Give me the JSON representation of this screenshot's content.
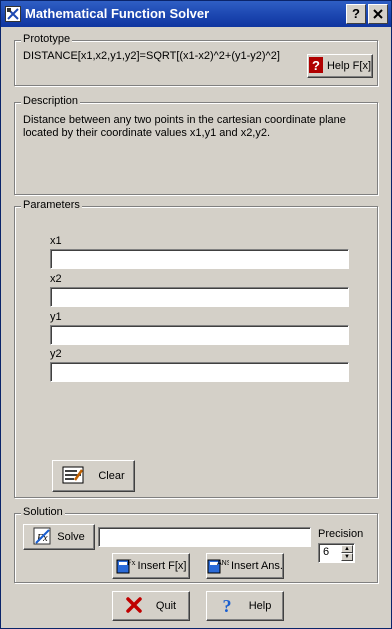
{
  "window": {
    "title": "Mathematical Function Solver",
    "help_button": "?",
    "close_button": "X"
  },
  "prototype": {
    "label": "Prototype",
    "text": "DISTANCE[x1,x2,y1,y2]=SQRT[(x1-x2)^2+(y1-y2)^2]",
    "help_button": "Help F[x]"
  },
  "description": {
    "label": "Description",
    "text": "Distance between any two points in the cartesian coordinate plane located by their coordinate values x1,y1 and x2,y2."
  },
  "parameters": {
    "label": "Parameters",
    "fields": [
      {
        "label": "x1",
        "value": ""
      },
      {
        "label": "x2",
        "value": ""
      },
      {
        "label": "y1",
        "value": ""
      },
      {
        "label": "y2",
        "value": ""
      }
    ],
    "clear_button": "Clear"
  },
  "solution": {
    "label": "Solution",
    "solve_button": "Solve",
    "result_value": "",
    "precision_label": "Precision",
    "precision_value": "6",
    "insert_fx_button": "Insert F[x]",
    "insert_ans_button": "Insert Ans."
  },
  "footer": {
    "quit_button": "Quit",
    "help_button": "Help"
  },
  "colors": {
    "titlebar": "#1d48b2",
    "face": "#d4d0c8",
    "quit_icon": "#c00000",
    "help_icon": "#1a5fd0"
  }
}
